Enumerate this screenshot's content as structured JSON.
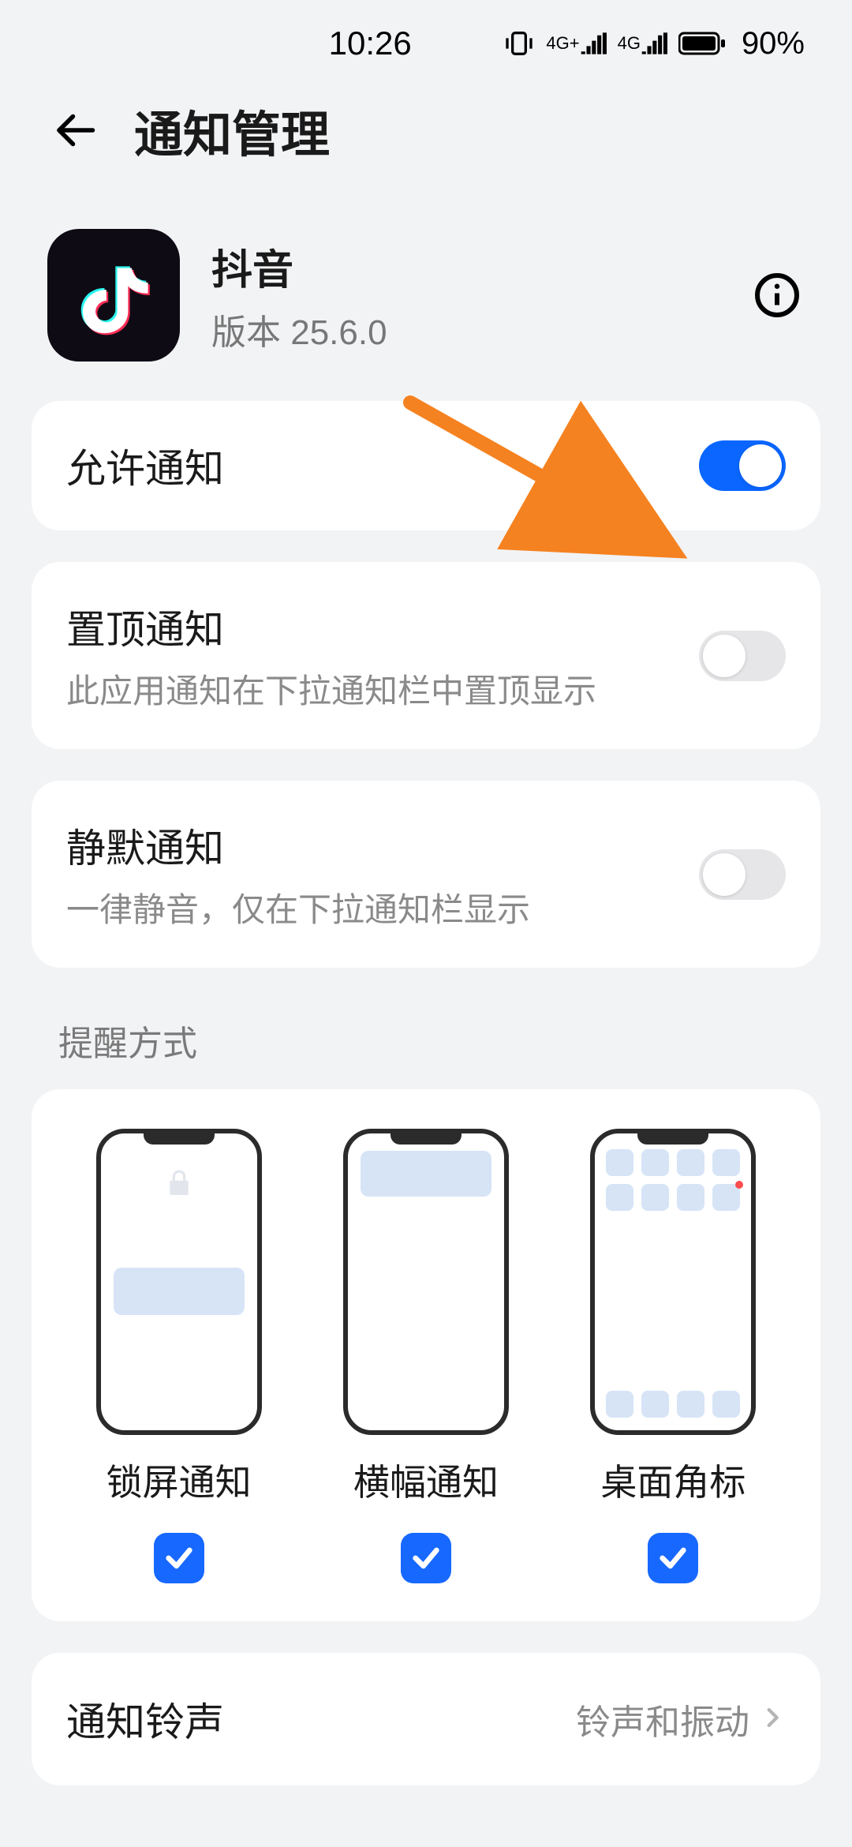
{
  "status": {
    "time": "10:26",
    "battery_percent": "90%",
    "network1": "4G+",
    "network2": "4G"
  },
  "header": {
    "title": "通知管理"
  },
  "app": {
    "name": "抖音",
    "version_label": "版本 25.6.0"
  },
  "rows": {
    "allow": {
      "title": "允许通知",
      "on": true
    },
    "pinned": {
      "title": "置顶通知",
      "sub": "此应用通知在下拉通知栏中置顶显示",
      "on": false
    },
    "silent": {
      "title": "静默通知",
      "sub": "一律静音，仅在下拉通知栏显示",
      "on": false
    }
  },
  "section": {
    "reminder_title": "提醒方式"
  },
  "styles": {
    "lock": {
      "label": "锁屏通知",
      "checked": true
    },
    "banner": {
      "label": "横幅通知",
      "checked": true
    },
    "badge": {
      "label": "桌面角标",
      "checked": true
    }
  },
  "ringtone": {
    "title": "通知铃声",
    "value": "铃声和振动"
  },
  "colors": {
    "accent": "#0a66ff",
    "arrow": "#f58220"
  }
}
